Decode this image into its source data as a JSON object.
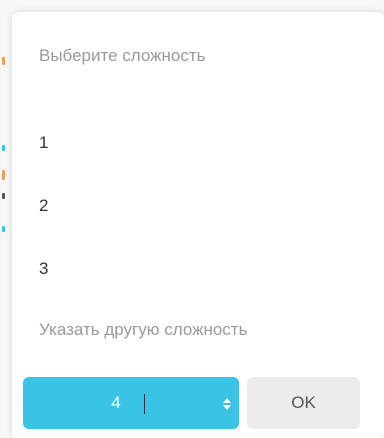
{
  "dialog": {
    "title": "Выберите сложность",
    "options": [
      {
        "label": "1"
      },
      {
        "label": "2"
      },
      {
        "label": "3"
      }
    ],
    "custom_label": "Указать другую сложность",
    "custom_input_value": "4",
    "ok_label": "OK"
  },
  "colors": {
    "accent": "#3bc3e6",
    "ok_bg": "#ececec",
    "muted_text": "#9a9a9a",
    "text": "#333333"
  },
  "icons": {
    "spinner": "up-down-stepper-icon"
  }
}
